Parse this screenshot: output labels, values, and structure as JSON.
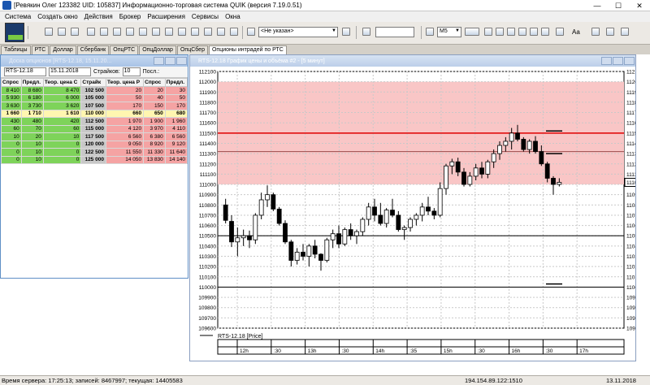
{
  "window": {
    "title": "[Ревякин Олег 123382 UID: 105837] Информационно-торговая система QUIK (версия 7.19.0.51)",
    "controls": [
      "—",
      "☐",
      "✕"
    ]
  },
  "menu": [
    "Система",
    "Создать окно",
    "Действия",
    "Брокер",
    "Расширения",
    "Сервисы",
    "Окна"
  ],
  "toolbar": {
    "account_combo": "<Не указан>",
    "interval_combo": "M5",
    "text_tool_label": "Aa"
  },
  "tabs": [
    "Таблицы",
    "РТС",
    "Доллар",
    "Сбербанк",
    "ОпцРТС",
    "ОпцДоллар",
    "ОпцСбер",
    "Опционы интрадей по РТС"
  ],
  "active_tab": "Опционы интрадей по РТС",
  "options_window": {
    "title": "Доска опционов [RTS-12.18, 15.11.20...",
    "base_asset": "RTS-12.18",
    "expiry": "15.11.2018",
    "strikes_label": "Страйков:",
    "strikes_value": "10",
    "last_label": "Посл.:",
    "columns": [
      "Спрос",
      "Предл.",
      "Теор. цена С",
      "Страйк",
      "Теор. цена Р",
      "Спрос",
      "Предл."
    ],
    "rows": [
      [
        "8 410",
        "8 680",
        "8 470",
        "102 500",
        "20",
        "20",
        "30"
      ],
      [
        "5 930",
        "6 180",
        "6 000",
        "105 000",
        "50",
        "40",
        "50"
      ],
      [
        "3 630",
        "3 730",
        "3 620",
        "107 500",
        "170",
        "150",
        "170"
      ],
      [
        "1 660",
        "1 710",
        "1 610",
        "110 000",
        "660",
        "650",
        "680"
      ],
      [
        "430",
        "480",
        "420",
        "112 500",
        "1 970",
        "1 900",
        "1 960"
      ],
      [
        "60",
        "70",
        "60",
        "115 000",
        "4 120",
        "3 970",
        "4 110"
      ],
      [
        "10",
        "20",
        "10",
        "117 500",
        "6 560",
        "6 380",
        "6 560"
      ],
      [
        "0",
        "10",
        "0",
        "120 000",
        "9 050",
        "8 920",
        "9 120"
      ],
      [
        "0",
        "10",
        "0",
        "122 500",
        "11 550",
        "11 330",
        "11 640"
      ],
      [
        "0",
        "10",
        "0",
        "125 000",
        "14 050",
        "13 830",
        "14 140"
      ]
    ],
    "highlight_row": 3
  },
  "chart_window": {
    "title": "RTS-12.18 График цены и объёма #2 - [5 минут]"
  },
  "chart_data": {
    "type": "candlestick",
    "series_label": "RTS-12.18 [Price]",
    "ylim": [
      109600,
      112100
    ],
    "y_ticks": [
      112100,
      112000,
      111900,
      111800,
      111700,
      111600,
      111500,
      111400,
      111300,
      111200,
      111100,
      111000,
      110900,
      110800,
      110700,
      110600,
      110500,
      110400,
      110300,
      110200,
      110100,
      110000,
      109900,
      109800,
      109700,
      109600
    ],
    "last_price": 111020,
    "zone": [
      111000,
      112000
    ],
    "lines": [
      {
        "y": 111500,
        "color": "#e00000"
      },
      {
        "y": 111320,
        "color": "#9b4a4a"
      },
      {
        "y": 110500,
        "color": "#000000"
      },
      {
        "y": 110000,
        "color": "#000000"
      }
    ],
    "short_marks": [
      111520,
      111300,
      110030
    ],
    "time_labels": [
      "12h",
      ":30",
      "13h",
      ":30",
      "14h",
      ":35",
      "15h",
      ":30",
      "16h",
      ":30",
      "17h"
    ],
    "candles": [
      [
        110800,
        110860,
        110620,
        110650
      ],
      [
        110640,
        110700,
        110390,
        110440
      ],
      [
        110440,
        110580,
        110300,
        110480
      ],
      [
        110480,
        110560,
        110400,
        110500
      ],
      [
        110500,
        110550,
        110380,
        110460
      ],
      [
        110460,
        110720,
        110420,
        110700
      ],
      [
        110700,
        110920,
        110660,
        110850
      ],
      [
        110850,
        110990,
        110780,
        110900
      ],
      [
        110900,
        110920,
        110740,
        110760
      ],
      [
        110760,
        110780,
        110600,
        110620
      ],
      [
        110620,
        110650,
        110420,
        110440
      ],
      [
        110440,
        110460,
        110200,
        110260
      ],
      [
        110260,
        110380,
        110220,
        110340
      ],
      [
        110340,
        110420,
        110260,
        110300
      ],
      [
        110300,
        110420,
        110200,
        110400
      ],
      [
        110400,
        110460,
        110280,
        110320
      ],
      [
        110320,
        110330,
        110160,
        110260
      ],
      [
        110260,
        110480,
        110240,
        110460
      ],
      [
        110460,
        110560,
        110380,
        110520
      ],
      [
        110520,
        110600,
        110380,
        110420
      ],
      [
        110420,
        110580,
        110400,
        110560
      ],
      [
        110560,
        110620,
        110460,
        110500
      ],
      [
        110500,
        110560,
        110420,
        110540
      ],
      [
        110540,
        110680,
        110500,
        110660
      ],
      [
        110660,
        110820,
        110600,
        110780
      ],
      [
        110780,
        110860,
        110640,
        110700
      ],
      [
        110700,
        110820,
        110600,
        110620
      ],
      [
        110620,
        110770,
        110580,
        110750
      ],
      [
        110750,
        110860,
        110680,
        110700
      ],
      [
        110700,
        110740,
        110540,
        110560
      ],
      [
        110560,
        110600,
        110460,
        110580
      ],
      [
        110580,
        110680,
        110540,
        110660
      ],
      [
        110660,
        110720,
        110600,
        110700
      ],
      [
        110700,
        110820,
        110640,
        110780
      ],
      [
        110780,
        110880,
        110700,
        110740
      ],
      [
        110740,
        110770,
        110660,
        110700
      ],
      [
        110700,
        111020,
        110680,
        110960
      ],
      [
        110960,
        111200,
        110900,
        111180
      ],
      [
        111180,
        111250,
        111100,
        111220
      ],
      [
        111220,
        111260,
        111080,
        111120
      ],
      [
        111120,
        111160,
        110980,
        111000
      ],
      [
        111000,
        111120,
        110980,
        111080
      ],
      [
        111080,
        111200,
        111040,
        111160
      ],
      [
        111160,
        111220,
        111060,
        111100
      ],
      [
        111100,
        111240,
        111060,
        111220
      ],
      [
        111220,
        111340,
        111160,
        111300
      ],
      [
        111300,
        111420,
        111240,
        111380
      ],
      [
        111380,
        111460,
        111320,
        111420
      ],
      [
        111420,
        111550,
        111340,
        111500
      ],
      [
        111500,
        111580,
        111420,
        111440
      ],
      [
        111440,
        111460,
        111320,
        111340
      ],
      [
        111340,
        111440,
        111300,
        111420
      ],
      [
        111420,
        111470,
        111300,
        111320
      ],
      [
        111320,
        111380,
        111180,
        111200
      ],
      [
        111200,
        111220,
        111020,
        111060
      ],
      [
        111060,
        111080,
        110900,
        111000
      ],
      [
        111000,
        111060,
        110980,
        111020
      ]
    ]
  },
  "status": {
    "server_time": "Время сервера: 17:25:13; записей: 8467997; текущая: 14405583",
    "connection": "194.154.89.122:1510",
    "date": "13.11.2018"
  }
}
